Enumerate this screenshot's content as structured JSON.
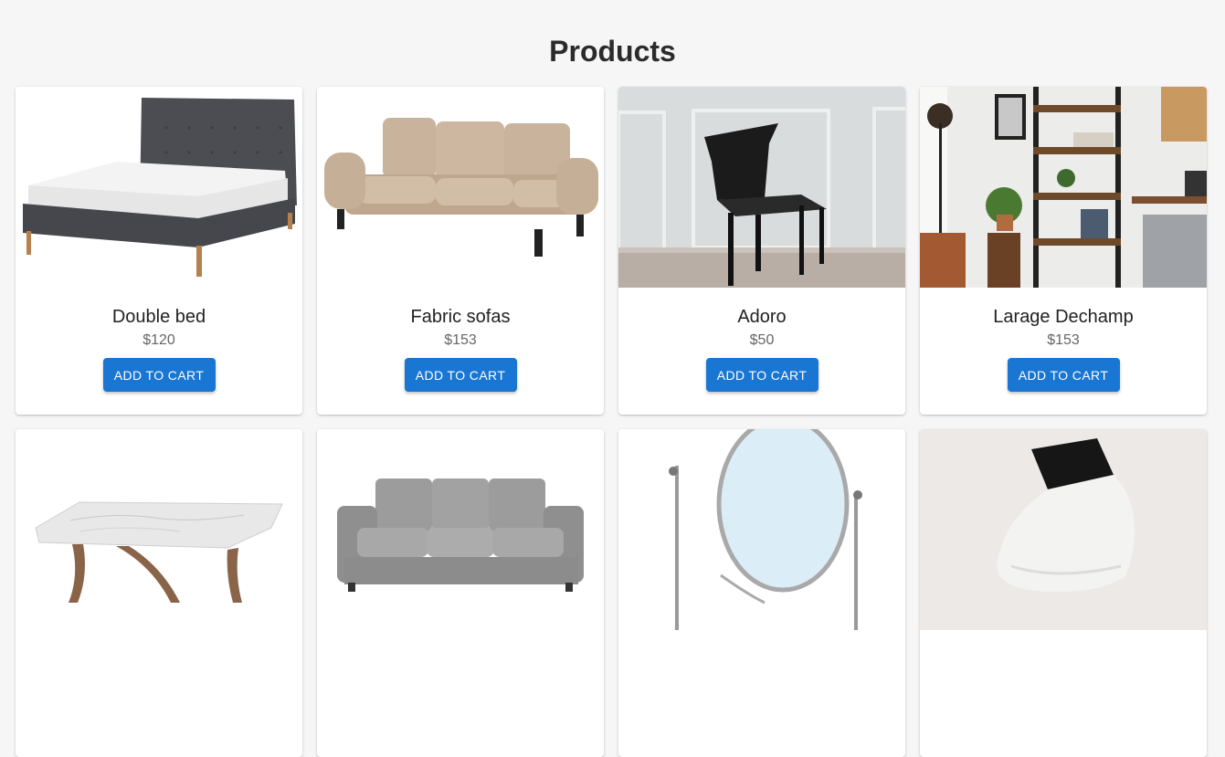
{
  "page": {
    "title": "Products"
  },
  "products": [
    {
      "name": "Double bed",
      "price": "$120",
      "button": "ADD TO CART",
      "image": "bed-image"
    },
    {
      "name": "Fabric sofas",
      "price": "$153",
      "button": "ADD TO CART",
      "image": "beige-sofa-image"
    },
    {
      "name": "Adoro",
      "price": "$50",
      "button": "ADD TO CART",
      "image": "black-chair-image"
    },
    {
      "name": "Larage Dechamp",
      "price": "$153",
      "button": "ADD TO CART",
      "image": "shelf-room-image"
    },
    {
      "name": "",
      "price": "",
      "button": "",
      "image": "marble-table-image"
    },
    {
      "name": "",
      "price": "",
      "button": "",
      "image": "grey-sofa-image"
    },
    {
      "name": "",
      "price": "",
      "button": "",
      "image": "round-mirror-image"
    },
    {
      "name": "",
      "price": "",
      "button": "",
      "image": "ceiling-lamp-image"
    }
  ],
  "colors": {
    "accent": "#1976d2",
    "background": "#f6f6f6"
  }
}
